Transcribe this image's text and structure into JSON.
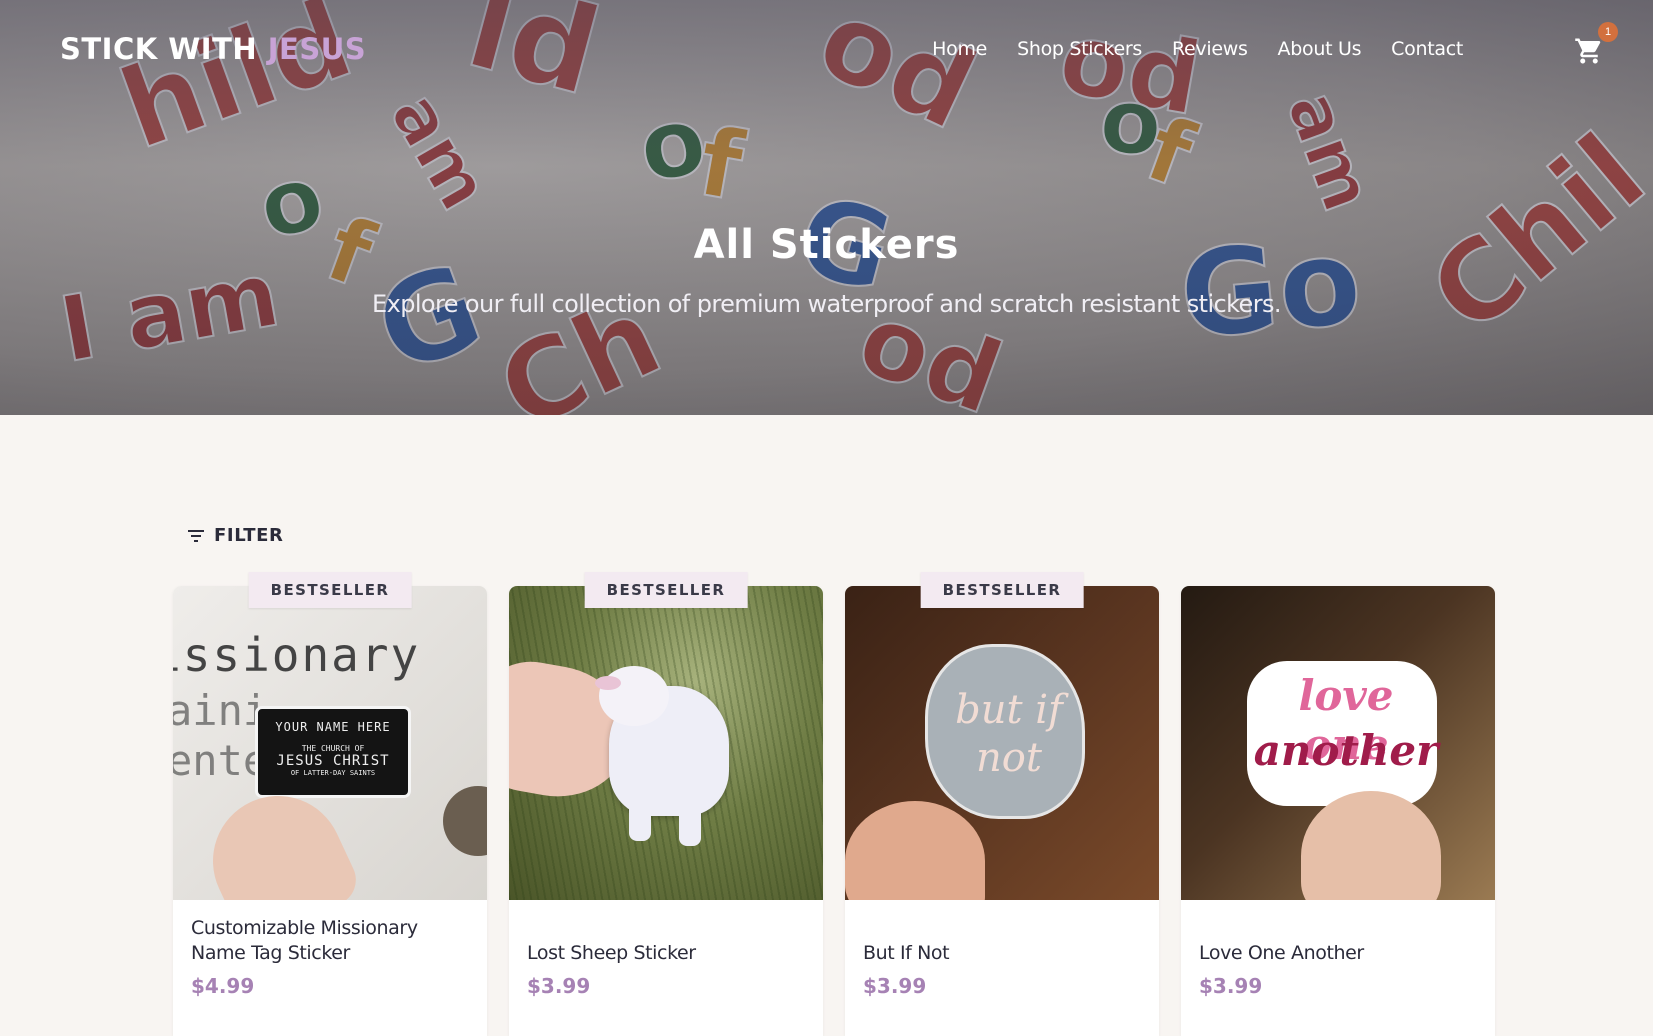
{
  "header": {
    "logo_main": "STICK WITH ",
    "logo_accent": "JESUS",
    "nav": [
      "Home",
      "Shop Stickers",
      "Reviews",
      "About Us",
      "Contact"
    ],
    "cart_count": "1"
  },
  "hero": {
    "title": "All Stickers",
    "subtitle": "Explore our full collection of premium waterproof and scratch resistant stickers."
  },
  "filter": {
    "label": "FILTER"
  },
  "products": [
    {
      "name": "Customizable Missionary Name Tag Sticker",
      "price": "$4.99",
      "badge": "BESTSELLER",
      "tag_line1": "YOUR NAME HERE",
      "tag_line2": "THE CHURCH OF",
      "tag_line3": "JESUS CHRIST",
      "tag_line4": "OF LATTER-DAY SAINTS",
      "bg_text": "issionary"
    },
    {
      "name": "Lost Sheep Sticker",
      "price": "$3.99",
      "badge": "BESTSELLER"
    },
    {
      "name": "But If Not",
      "price": "$3.99",
      "badge": "BESTSELLER",
      "sticker_text": "but if not"
    },
    {
      "name": "Love One Another",
      "price": "$3.99",
      "badge": "",
      "sticker_line1": "love one",
      "sticker_line2": "another"
    }
  ],
  "colors": {
    "accent": "#a682b4",
    "logo_accent": "#c8a3d6",
    "cart_badge": "#d2703e",
    "page_bg": "#f8f5f2"
  },
  "icons": {
    "cart": "shopping-cart-icon",
    "filter": "filter-lines-icon"
  }
}
